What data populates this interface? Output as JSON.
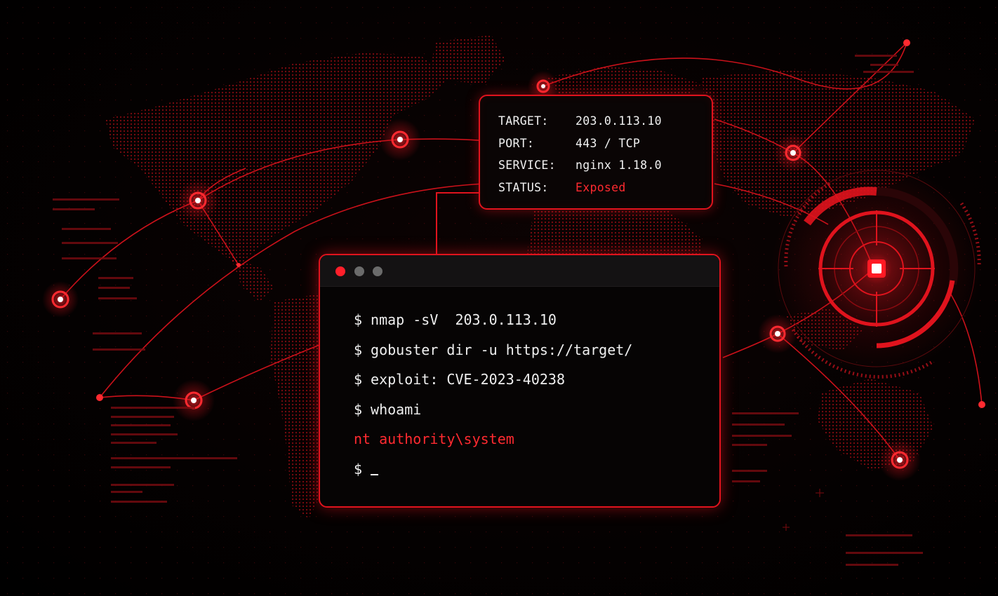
{
  "target_card": {
    "rows": [
      {
        "key": "TARGET:",
        "value": "203.0.113.10"
      },
      {
        "key": "PORT:",
        "value": "443 / TCP"
      },
      {
        "key": "SERVICE:",
        "value": "nginx 1.18.0"
      },
      {
        "key": "STATUS:",
        "value": "Exposed"
      }
    ]
  },
  "terminal": {
    "prompt": "$",
    "lines": [
      {
        "kind": "command",
        "text": "nmap -sV  203.0.113.10"
      },
      {
        "kind": "command",
        "text": "gobuster dir -u https://target/"
      },
      {
        "kind": "command",
        "text": "exploit: CVE-2023-40238"
      },
      {
        "kind": "command",
        "text": "whoami"
      },
      {
        "kind": "output",
        "text": "nt authority\\system"
      }
    ]
  },
  "colors": {
    "accent": "#e0131d",
    "status": "#ff2a30",
    "text": "#efefef",
    "background": "#000000"
  },
  "icons": [
    "window-close-dot",
    "window-minimize-dot",
    "window-maximize-dot",
    "location-marker-icon",
    "crosshair-target-icon"
  ]
}
